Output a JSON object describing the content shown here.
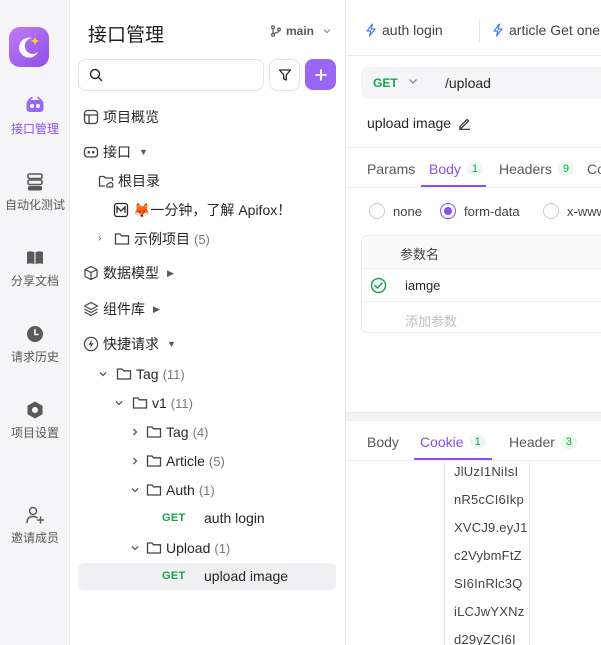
{
  "rail": {
    "items": [
      {
        "label": "接口管理",
        "icon": "api-icon",
        "active": true
      },
      {
        "label": "自动化测试",
        "icon": "auto-test-icon",
        "active": false
      },
      {
        "label": "分享文档",
        "icon": "book-icon",
        "active": false
      },
      {
        "label": "请求历史",
        "icon": "clock-icon",
        "active": false
      },
      {
        "label": "项目设置",
        "icon": "hexagon-icon",
        "active": false
      },
      {
        "label": "邀请成员",
        "icon": "add-user-icon",
        "active": false
      }
    ]
  },
  "tree_panel": {
    "title": "接口管理",
    "branch": "main",
    "search": {
      "placeholder": "",
      "value": ""
    },
    "nodes": [
      {
        "label": "项目概览",
        "icon": "layout-icon"
      },
      {
        "label": "接口",
        "icon": "api-icon"
      },
      {
        "label": "根目录",
        "icon": "folder-cloud-icon"
      },
      {
        "label": "🦊一分钟，了解 Apifox！",
        "icon": "markdown-icon"
      },
      {
        "label": "示例项目",
        "count": "(5)",
        "icon": "folder-icon"
      },
      {
        "label": "数据模型",
        "icon": "cube-icon"
      },
      {
        "label": "组件库",
        "icon": "layers-icon"
      },
      {
        "label": "快捷请求",
        "icon": "lightning-icon"
      },
      {
        "label": "Tag",
        "count": "(11)",
        "icon": "folder-icon"
      },
      {
        "label": "v1",
        "count": "(11)",
        "icon": "folder-icon"
      },
      {
        "label": "Tag",
        "count": "(4)",
        "icon": "folder-icon"
      },
      {
        "label": "Article",
        "count": "(5)",
        "icon": "folder-icon"
      },
      {
        "label": "Auth",
        "count": "(1)",
        "icon": "folder-icon"
      },
      {
        "method": "GET",
        "label": "auth login"
      },
      {
        "label": "Upload",
        "count": "(1)",
        "icon": "folder-icon"
      },
      {
        "method": "GET",
        "label": "upload image"
      }
    ]
  },
  "open_tabs": [
    {
      "label": "auth login",
      "icon": "lightning-icon"
    },
    {
      "label": "article Get one",
      "icon": "lightning-icon"
    }
  ],
  "request": {
    "method": "GET",
    "url": "/upload",
    "name": "upload image",
    "param_tabs": [
      {
        "label": "Params",
        "badge": null,
        "active": false
      },
      {
        "label": "Body",
        "badge": "1",
        "active": true
      },
      {
        "label": "Headers",
        "badge": "9",
        "active": false
      },
      {
        "label": "Co",
        "badge": null,
        "active": false
      }
    ],
    "body_types": [
      {
        "label": "none",
        "selected": false
      },
      {
        "label": "form-data",
        "selected": true
      },
      {
        "label": "x-www",
        "selected": false
      }
    ],
    "table": {
      "header": "参数名",
      "rows": [
        {
          "name": "iamge",
          "enabled": true
        }
      ],
      "add_placeholder": "添加参数"
    }
  },
  "response": {
    "tabs": [
      {
        "label": "Body",
        "badge": null,
        "active": false
      },
      {
        "label": "Cookie",
        "badge": "1",
        "active": true
      },
      {
        "label": "Header",
        "badge": "3",
        "active": false
      }
    ],
    "cookie_lines": [
      "JlUzI1NiIsI",
      "nR5cCI6Ikp",
      "XVCJ9.eyJ1",
      "c2VybmFtZ",
      "SI6InRlc3Q",
      "iLCJwYXNz",
      "d29yZCI6I"
    ]
  },
  "colors": {
    "accent": "#8a4ff0",
    "get_method": "#16a34a"
  }
}
